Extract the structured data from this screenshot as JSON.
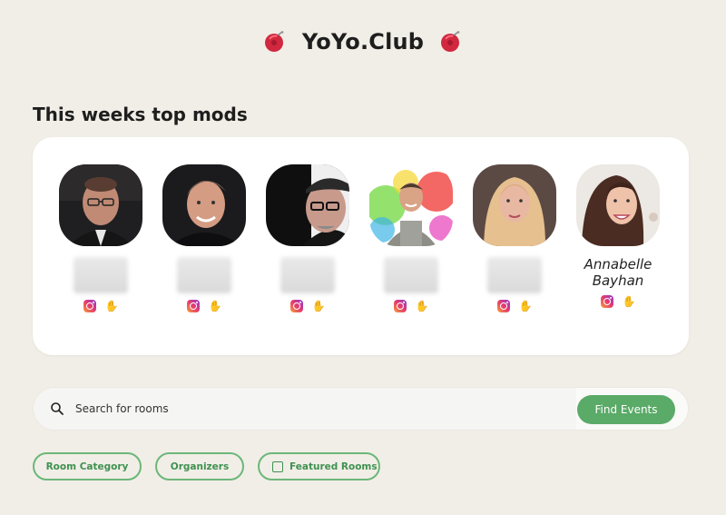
{
  "header": {
    "title": "YoYo.Club",
    "left_icon": "yoyo-icon",
    "right_icon": "yoyo-icon"
  },
  "section": {
    "title": "This weeks top mods"
  },
  "mods": [
    {
      "name": "",
      "name_visible": false,
      "avatar": "avatar-photo",
      "icons": [
        "instagram-icon",
        "wave-icon"
      ]
    },
    {
      "name": "",
      "name_visible": false,
      "avatar": "avatar-photo",
      "icons": [
        "instagram-icon",
        "wave-icon"
      ]
    },
    {
      "name": "",
      "name_visible": false,
      "avatar": "avatar-photo",
      "icons": [
        "instagram-icon",
        "wave-icon"
      ]
    },
    {
      "name": "",
      "name_visible": false,
      "avatar": "avatar-photo",
      "icons": [
        "instagram-icon",
        "wave-icon"
      ]
    },
    {
      "name": "",
      "name_visible": false,
      "avatar": "avatar-photo",
      "icons": [
        "instagram-icon",
        "wave-icon"
      ]
    },
    {
      "name": "Annabelle Bayhan",
      "name_visible": true,
      "avatar": "avatar-photo",
      "icons": [
        "instagram-icon",
        "wave-icon"
      ]
    }
  ],
  "search": {
    "placeholder": "Search for rooms",
    "value": "",
    "button_label": "Find Events"
  },
  "filters": {
    "room_category": "Room Category",
    "organizers": "Organizers",
    "featured_rooms": "Featured Rooms",
    "featured_checked": false
  },
  "colors": {
    "background": "#f1eee7",
    "card": "#ffffff",
    "accent_green": "#5aaa68",
    "chip_border": "#6cb779",
    "yoyo_red": "#d1283f"
  }
}
